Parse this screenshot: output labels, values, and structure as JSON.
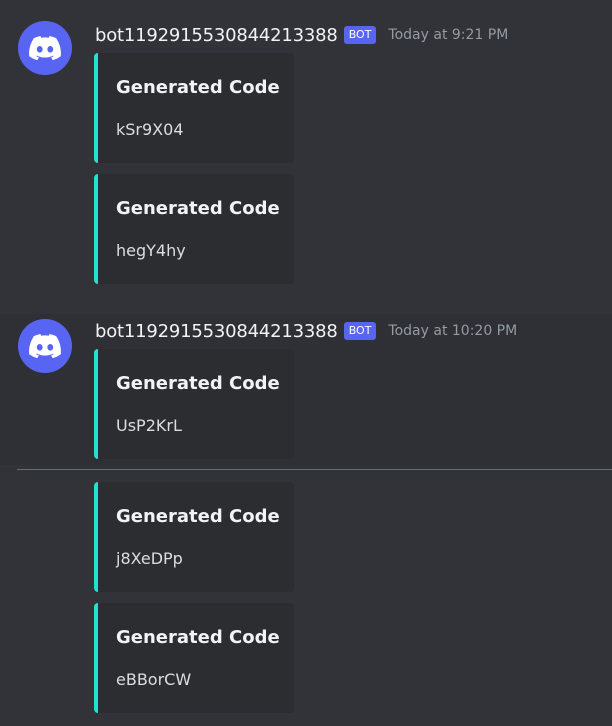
{
  "colors": {
    "background": "#313338",
    "embed_background": "#2b2d31",
    "embed_accent": "#1fe2d0",
    "bot_tag": "#5865f2",
    "avatar": "#5865f2",
    "new_messages_divider": "#f23f43"
  },
  "messages": [
    {
      "username": "bot1192915530844213388",
      "tag": "BOT",
      "timestamp": "Today at 9:21 PM",
      "avatar_icon": "discord-logo-icon",
      "embeds": [
        {
          "title": "Generated Code",
          "description": "kSr9X04"
        },
        {
          "title": "Generated Code",
          "description": "hegY4hy"
        }
      ]
    },
    {
      "username": "bot1192915530844213388",
      "tag": "BOT",
      "timestamp": "Today at 10:20 PM",
      "avatar_icon": "discord-logo-icon",
      "embeds": [
        {
          "title": "Generated Code",
          "description": "UsP2KrL"
        },
        {
          "title": "Generated Code",
          "description": "j8XeDPp"
        },
        {
          "title": "Generated Code",
          "description": "eBBorCW"
        }
      ]
    }
  ]
}
